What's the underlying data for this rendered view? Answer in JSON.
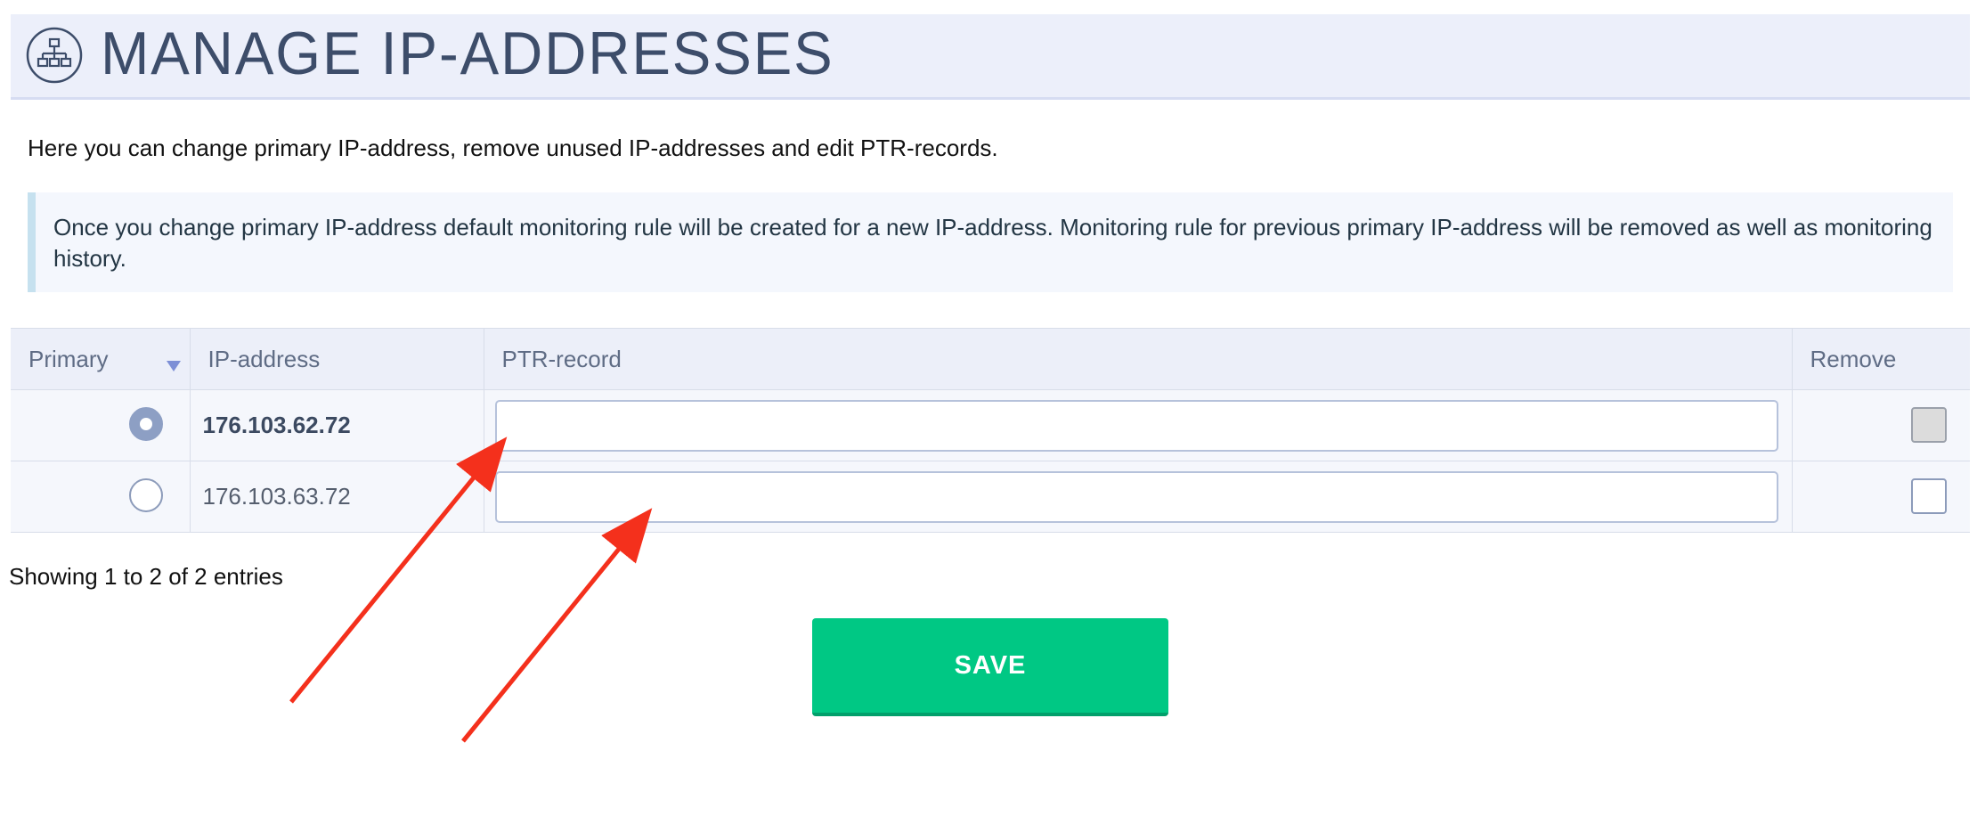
{
  "header": {
    "title": "MANAGE IP-ADDRESSES",
    "icon": "network-icon"
  },
  "intro": "Here you can change primary IP-address, remove unused IP-addresses and edit PTR-records.",
  "notice": "Once you change primary IP-address default monitoring rule will be created for a new IP-address. Monitoring rule for previous primary IP-address will be removed as well as monitoring history.",
  "table": {
    "columns": {
      "primary": "Primary",
      "ip": "IP-address",
      "ptr": "PTR-record",
      "remove": "Remove"
    },
    "rows": [
      {
        "ip": "176.103.62.72",
        "ptr": "",
        "primary": true,
        "remove_disabled": true
      },
      {
        "ip": "176.103.63.72",
        "ptr": "",
        "primary": false,
        "remove_disabled": false
      }
    ]
  },
  "entries": "Showing 1 to 2 of 2 entries",
  "save_label": "SAVE",
  "colors": {
    "accent_green": "#00c884",
    "annotation_red": "#f4301c",
    "header_bg": "#eceffa"
  }
}
